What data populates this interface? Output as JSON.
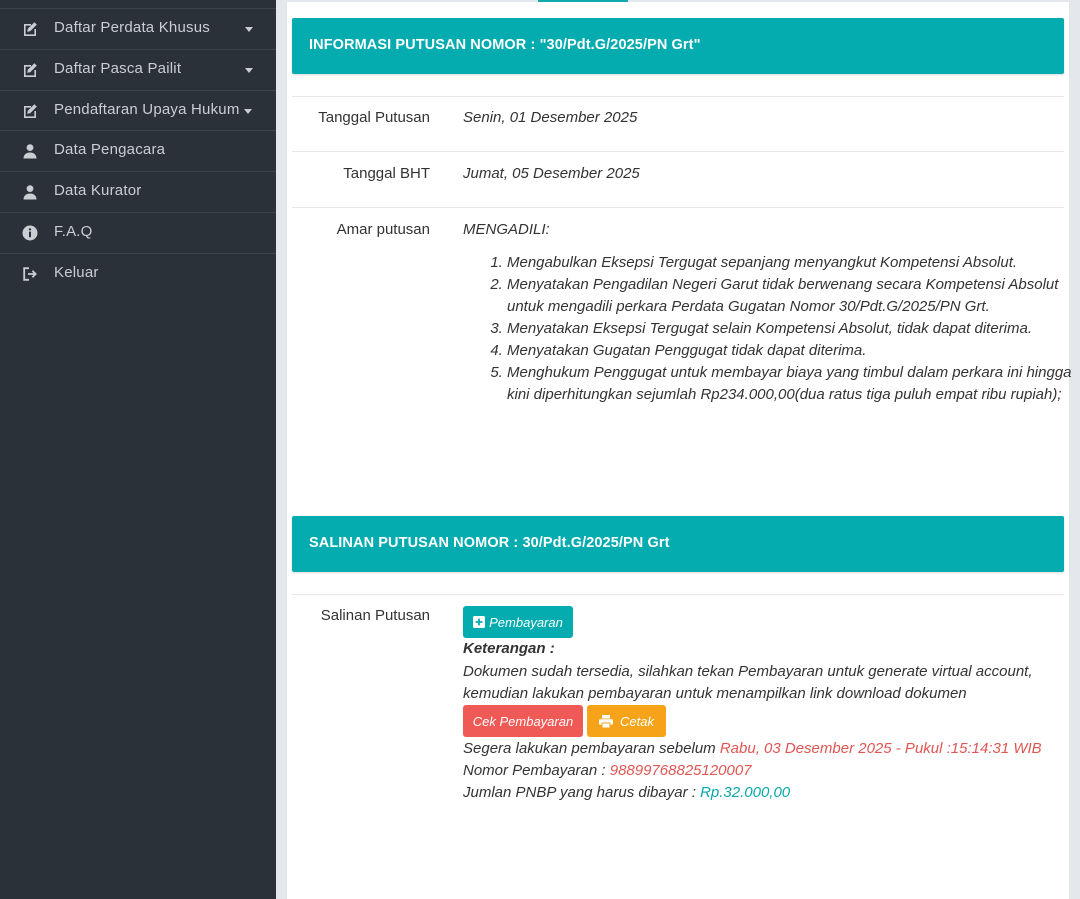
{
  "sidebar": {
    "items": [
      {
        "label": "Daftar Perdata Khusus",
        "icon": "edit-icon",
        "has_caret": true
      },
      {
        "label": "Daftar Pasca Pailit",
        "icon": "edit-icon",
        "has_caret": true
      },
      {
        "label": "Pendaftaran Upaya Hukum",
        "icon": "edit-icon",
        "has_caret": true
      },
      {
        "label": "Data Pengacara",
        "icon": "user-icon",
        "has_caret": false
      },
      {
        "label": "Data Kurator",
        "icon": "user-icon",
        "has_caret": false
      },
      {
        "label": "F.A.Q",
        "icon": "info-icon",
        "has_caret": false
      },
      {
        "label": "Keluar",
        "icon": "sign-out-icon",
        "has_caret": false
      }
    ]
  },
  "info_panel": {
    "title": "INFORMASI PUTUSAN NOMOR : \"30/Pdt.G/2025/PN Grt\"",
    "tanggal_putusan_label": "Tanggal Putusan",
    "tanggal_putusan_value": "Senin, 01 Desember 2025",
    "tanggal_bht_label": "Tanggal BHT",
    "tanggal_bht_value": "Jumat, 05 Desember 2025",
    "amar_label": "Amar putusan",
    "amar_heading": "MENGADILI:",
    "amar_items": [
      "Mengabulkan Eksepsi Tergugat sepanjang menyangkut Kompetensi Absolut.",
      "Menyatakan Pengadilan Negeri Garut tidak berwenang secara Kompetensi Absolut untuk mengadili perkara Perdata Gugatan Nomor 30/Pdt.G/2025/PN Grt.",
      "Menyatakan Eksepsi Tergugat selain Kompetensi Absolut, tidak dapat diterima.",
      "Menyatakan Gugatan Penggugat tidak dapat diterima.",
      "Menghukum Penggugat untuk membayar biaya yang timbul dalam perkara ini hingga kini diperhitungkan sejumlah Rp234.000,00(dua ratus tiga puluh empat ribu rupiah);"
    ]
  },
  "salinan_panel": {
    "title": "SALINAN PUTUSAN NOMOR : 30/Pdt.G/2025/PN Grt",
    "label": "Salinan Putusan",
    "pembayaran_button": "Pembayaran",
    "keterangan_label": "Keterangan :",
    "keterangan_line1": "Dokumen sudah tersedia, silahkan tekan Pembayaran untuk generate virtual account,",
    "keterangan_line2": "kemudian lakukan pembayaran untuk menampilkan link download dokumen",
    "cek_button": "Cek Pembayaran",
    "cetak_button": "Cetak",
    "deadline_prefix": "Segera lakukan pembayaran sebelum ",
    "deadline_value": "Rabu, 03 Desember 2025 - Pukul :15:14:31 WIB",
    "nomor_prefix": "Nomor Pembayaran : ",
    "nomor_value": "98899768825120007",
    "jumlah_prefix": "Jumlan PNBP yang harus dibayar : ",
    "jumlah_value": "Rp.32.000,00"
  },
  "colors": {
    "teal": "#04abaf",
    "red": "#f05a56",
    "orange": "#f6a319",
    "sidebar_bg": "#2b3138"
  }
}
